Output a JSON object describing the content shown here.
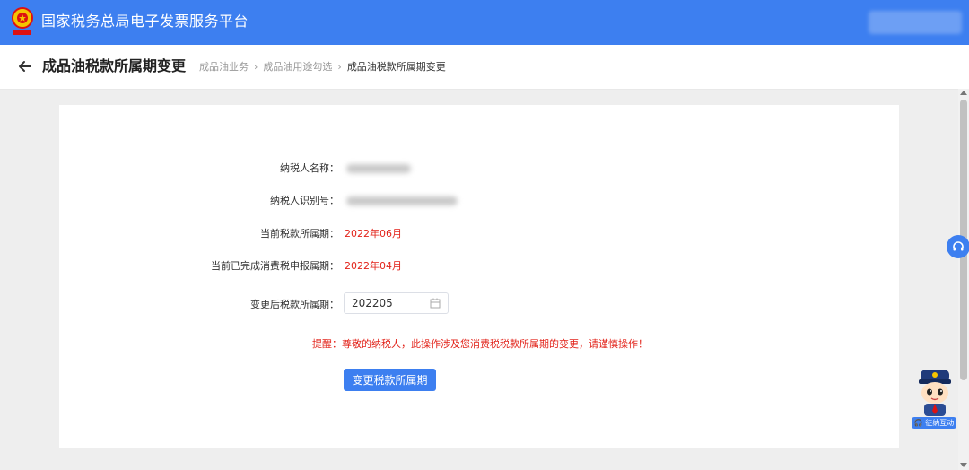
{
  "header": {
    "title": "国家税务总局电子发票服务平台",
    "emblem_icon": "tax-emblem-icon"
  },
  "subheader": {
    "back_icon": "arrow-left-icon",
    "page_title": "成品油税款所属期变更",
    "breadcrumb": [
      "成品油业务",
      "成品油用途勾选",
      "成品油税款所属期变更"
    ]
  },
  "form": {
    "taxpayer_name_label": "纳税人名称：",
    "taxpayer_id_label": "纳税人识别号：",
    "current_period_label": "当前税款所属期：",
    "current_period_value": "2022年06月",
    "consumption_period_label": "当前已完成消费税申报属期：",
    "consumption_period_value": "2022年04月",
    "new_period_label": "变更后税款所属期：",
    "new_period_value": "202205",
    "reminder": "提醒：尊敬的纳税人，此操作涉及您消费税税款所属期的变更，请谨慎操作！",
    "submit_label": "变更税款所属期"
  },
  "floating": {
    "mascot_label": "征纳互动"
  },
  "colors": {
    "primary": "#3d7ff0",
    "warning": "#e2231a"
  }
}
